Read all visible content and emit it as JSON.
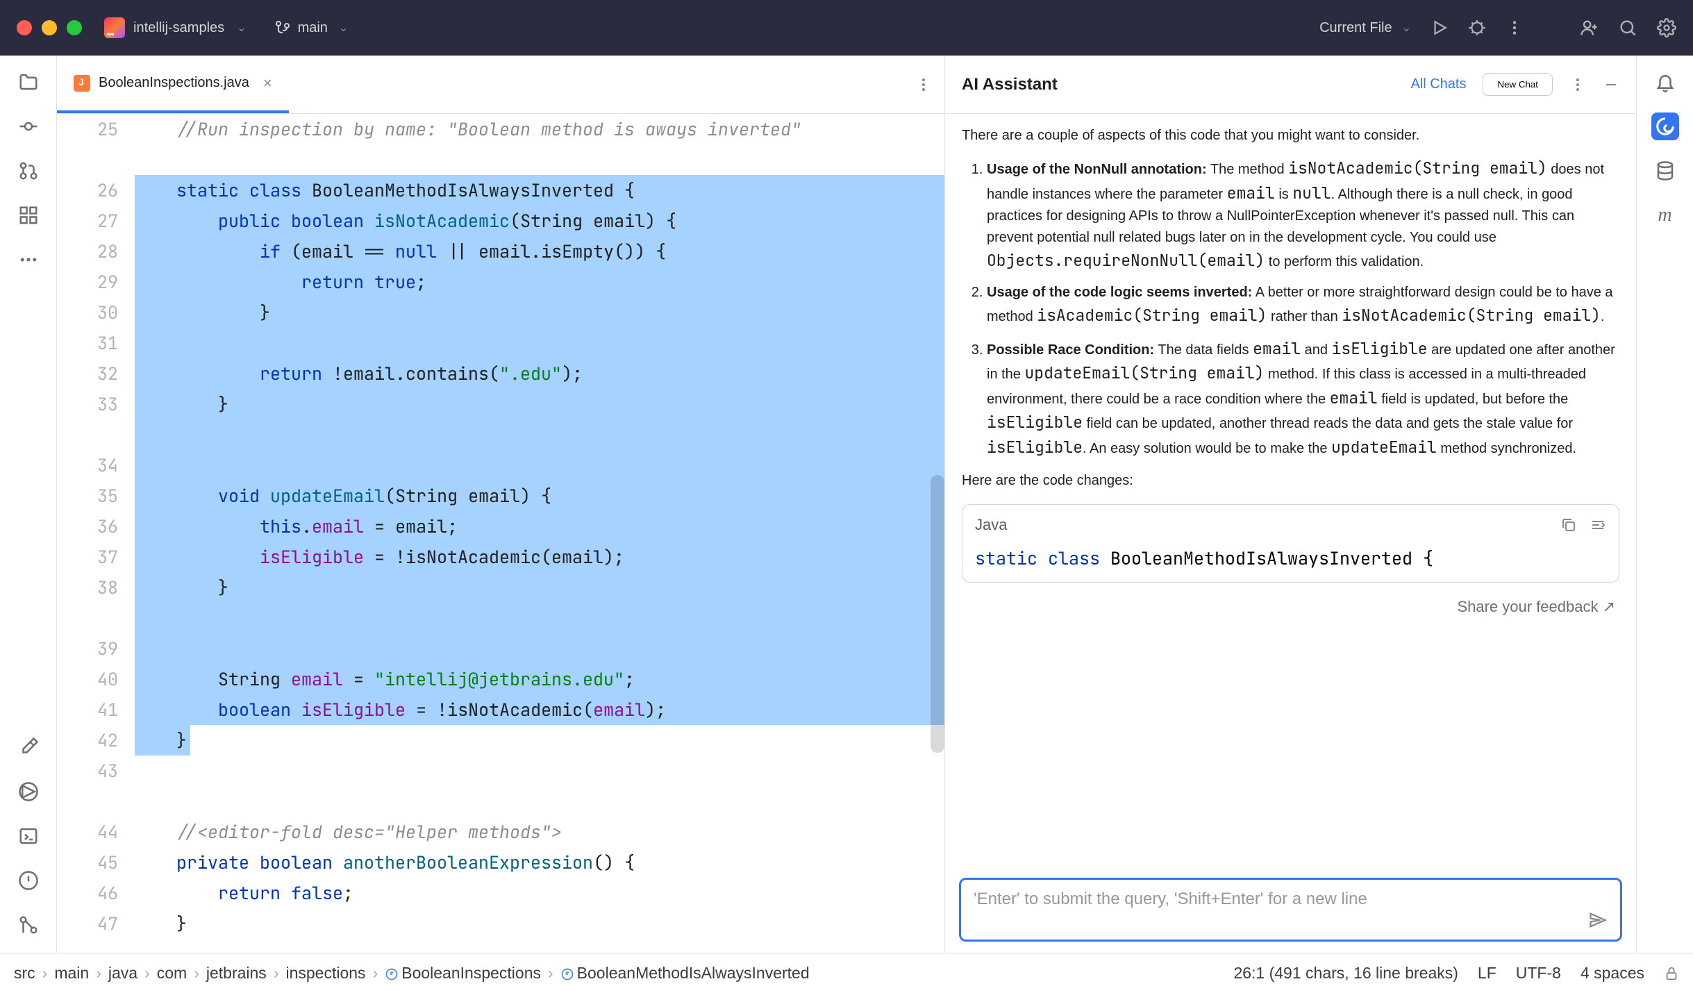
{
  "titlebar": {
    "project_name": "intellij-samples",
    "branch": "main",
    "run_config": "Current File"
  },
  "editor": {
    "tab_name": "BooleanInspections.java",
    "first_line_number": 25,
    "lines": [
      {
        "n": 25,
        "sel": false,
        "html": "    <span class='cm-comment'>//Run inspection by name: \"Boolean method is aways inverted\"</span>"
      },
      {
        "n": 26,
        "sel": true,
        "html": "    <span class='cm-kw'>static class</span> BooleanMethodIsAlwaysInverted {",
        "current": true
      },
      {
        "n": 27,
        "sel": true,
        "html": "        <span class='cm-kw'>public boolean</span> <span class='cm-meth'>isNotAcademic</span>(String email) {"
      },
      {
        "n": 28,
        "sel": true,
        "html": "            <span class='cm-kw'>if</span> (email == <span class='cm-kw'>null</span> || email.isEmpty()) {"
      },
      {
        "n": 29,
        "sel": true,
        "html": "                <span class='cm-kw'>return true</span>;"
      },
      {
        "n": 30,
        "sel": true,
        "html": "            }"
      },
      {
        "n": 31,
        "sel": true,
        "html": ""
      },
      {
        "n": 32,
        "sel": true,
        "html": "            <span class='cm-kw'>return</span> !email.contains(<span class='cm-str'>\".edu\"</span>);"
      },
      {
        "n": 33,
        "sel": true,
        "html": "        }"
      },
      {
        "n": 34,
        "sel": true,
        "html": ""
      },
      {
        "n": 35,
        "sel": true,
        "html": "        <span class='cm-kw'>void</span> <span class='cm-meth'>updateEmail</span>(String email) {"
      },
      {
        "n": 36,
        "sel": true,
        "html": "            <span class='cm-kw'>this</span>.<span class='cm-field'>email</span> = email;"
      },
      {
        "n": 37,
        "sel": true,
        "html": "            <span class='cm-field'>isEligible</span> = !isNotAcademic(email);"
      },
      {
        "n": 38,
        "sel": true,
        "html": "        }"
      },
      {
        "n": 39,
        "sel": true,
        "html": ""
      },
      {
        "n": 40,
        "sel": true,
        "html": "        String <span class='cm-field'>email</span> = <span class='cm-str'>\"intellij@jetbrains.edu\"</span>;"
      },
      {
        "n": 41,
        "sel": true,
        "html": "        <span class='cm-kw'>boolean</span> <span class='cm-field'>isEligible</span> = !isNotAcademic(<span class='cm-field'>email</span>);"
      },
      {
        "n": 42,
        "sel": true,
        "html": "    }",
        "sel_last": true
      },
      {
        "n": 43,
        "sel": false,
        "html": ""
      },
      {
        "n": 44,
        "sel": false,
        "html": "    <span class='cm-comment'>//&lt;editor-fold desc=\"Helper methods\"&gt;</span>"
      },
      {
        "n": 45,
        "sel": false,
        "html": "    <span class='cm-kw'>private boolean</span> <span class='cm-meth'>anotherBooleanExpression</span>() {"
      },
      {
        "n": 46,
        "sel": false,
        "html": "        <span class='cm-kw'>return false</span>;"
      },
      {
        "n": 47,
        "sel": false,
        "html": "    }"
      }
    ],
    "blank_after": [
      25,
      33,
      38,
      43
    ]
  },
  "ai": {
    "title": "AI Assistant",
    "all_chats": "All Chats",
    "new_chat": "New Chat",
    "intro": "There are a couple of aspects of this code that you might want to consider.",
    "points": [
      {
        "title": "Usage of the NonNull annotation:",
        "body": " The method <code>isNotAcademic(String email)</code> does not handle instances where the parameter <code>email</code> is <code>null</code>. Although there is a null check, in good practices for designing APIs to throw a NullPointerException whenever it's passed null. This can prevent potential null related bugs later on in the development cycle. You could use <code>Objects.requireNonNull(email)</code> to perform this validation."
      },
      {
        "title": "Usage of the code logic seems inverted:",
        "body": " A better or more straightforward design could be to have a method <code>isAcademic(String email)</code> rather than <code>isNotAcademic(String email)</code>."
      },
      {
        "title": "Possible Race Condition:",
        "body": " The data fields <code>email</code> and <code>isEligible</code> are updated one after another in the <code>updateEmail(String email)</code> method. If this class is accessed in a multi-threaded environment, there could be a race condition where the <code>email</code> field is updated, but before the <code>isEligible</code> field can be updated, another thread reads the data and gets the stale value for <code>isEligible</code>. An easy solution would be to make the <code>updateEmail</code> method synchronized."
      }
    ],
    "changes_label": "Here are the code changes:",
    "code_lang": "Java",
    "code_snippet_html": "<span class='cm-kw'>static class</span> BooleanMethodIsAlwaysInverted {",
    "feedback": "Share your feedback ↗",
    "input_placeholder": "'Enter' to submit the query, 'Shift+Enter' for a new line"
  },
  "breadcrumb": [
    "src",
    "main",
    "java",
    "com",
    "jetbrains",
    "inspections",
    "BooleanInspections",
    "BooleanMethodIsAlwaysInverted"
  ],
  "status": {
    "position": "26:1 (491 chars, 16 line breaks)",
    "line_sep": "LF",
    "encoding": "UTF-8",
    "indent": "4 spaces"
  }
}
